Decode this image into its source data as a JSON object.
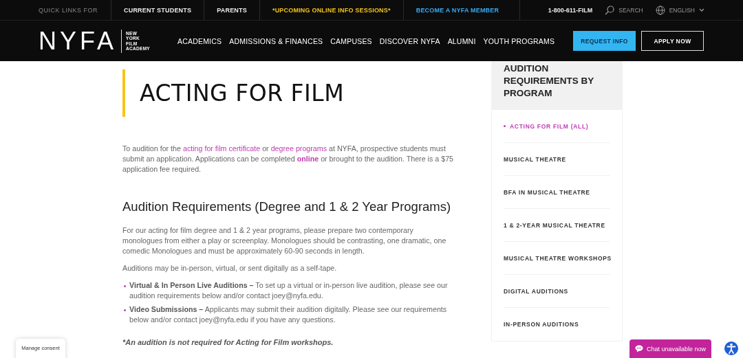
{
  "top_bar": {
    "label": "QUICK LINKS FOR",
    "links": [
      {
        "text": "CURRENT STUDENTS",
        "kind": "plain"
      },
      {
        "text": "PARENTS",
        "kind": "plain"
      },
      {
        "text": "*UPCOMING ONLINE INFO SESSIONS*",
        "kind": "highlight"
      },
      {
        "text": "BECOME A NYFA MEMBER",
        "kind": "member"
      }
    ],
    "phone": "1-800-611-FILM",
    "search": "SEARCH",
    "language": "ENGLISH"
  },
  "header": {
    "logo": {
      "mark": "NYFA",
      "lines": [
        "NEW",
        "YORK",
        "FILM",
        "ACADEMY"
      ]
    },
    "nav": [
      "ACADEMICS",
      "ADMISSIONS & FINANCES",
      "CAMPUSES",
      "DISCOVER NYFA",
      "ALUMNI",
      "YOUTH PROGRAMS"
    ],
    "buttons": [
      {
        "label": "REQUEST INFO",
        "kind": "primary"
      },
      {
        "label": "APPLY NOW",
        "kind": "outline"
      }
    ]
  },
  "page_title": "ACTING FOR FILM",
  "intro": [
    {
      "kind": "text",
      "text": "To audition for the "
    },
    {
      "kind": "link",
      "text": "acting for film certificate"
    },
    {
      "kind": "text",
      "text": " or "
    },
    {
      "kind": "link",
      "text": "degree programs"
    },
    {
      "kind": "text",
      "text": " at NYFA, prospective students must submit an application. Applications can be completed "
    },
    {
      "kind": "strong_link",
      "text": "online"
    },
    {
      "kind": "text",
      "text": " or brought to the audition. There is a $75 application fee required."
    }
  ],
  "section": {
    "heading": "Audition Requirements (Degree and 1 & 2 Year Programs)",
    "paragraphs": [
      "For our acting for film degree and 1 & 2 year programs, please prepare two contemporary monologues from either a play or screenplay. Monologues should be contrasting, one dramatic, one comedic Monologues and must be approximately 60-90 seconds in length.",
      "Auditions may be in-person, virtual, or sent digitally as a self-tape."
    ],
    "bullets": [
      "**Virtual & In Person Live Auditions –** To set up a virtual or in-person live audition, please see our audition requirements below and/or contact joey@nyfa.edu.",
      "**Video Submissions –** Applicants may submit their audition digitally. Please see our requirements below and/or contact joey@nyfa.edu if you have any questions."
    ],
    "note": "*An audition is not required for Acting for Film workshops."
  },
  "sidebar": {
    "title": "AUDITION REQUIREMENTS BY PROGRAM",
    "items": [
      {
        "label": "ACTING FOR FILM (ALL)",
        "selected": true
      },
      {
        "label": "MUSICAL THEATRE",
        "selected": false
      },
      {
        "label": "BFA IN MUSICAL THEATRE",
        "selected": false
      },
      {
        "label": "1 & 2-YEAR MUSICAL THEATRE",
        "selected": false
      },
      {
        "label": "MUSICAL THEATRE WORKSHOPS",
        "selected": false
      },
      {
        "label": "DIGITAL AUDITIONS",
        "selected": false
      },
      {
        "label": "IN-PERSON AUDITIONS",
        "selected": false
      }
    ]
  },
  "consent": "Manage consent",
  "chat": "Chat unavailable now"
}
